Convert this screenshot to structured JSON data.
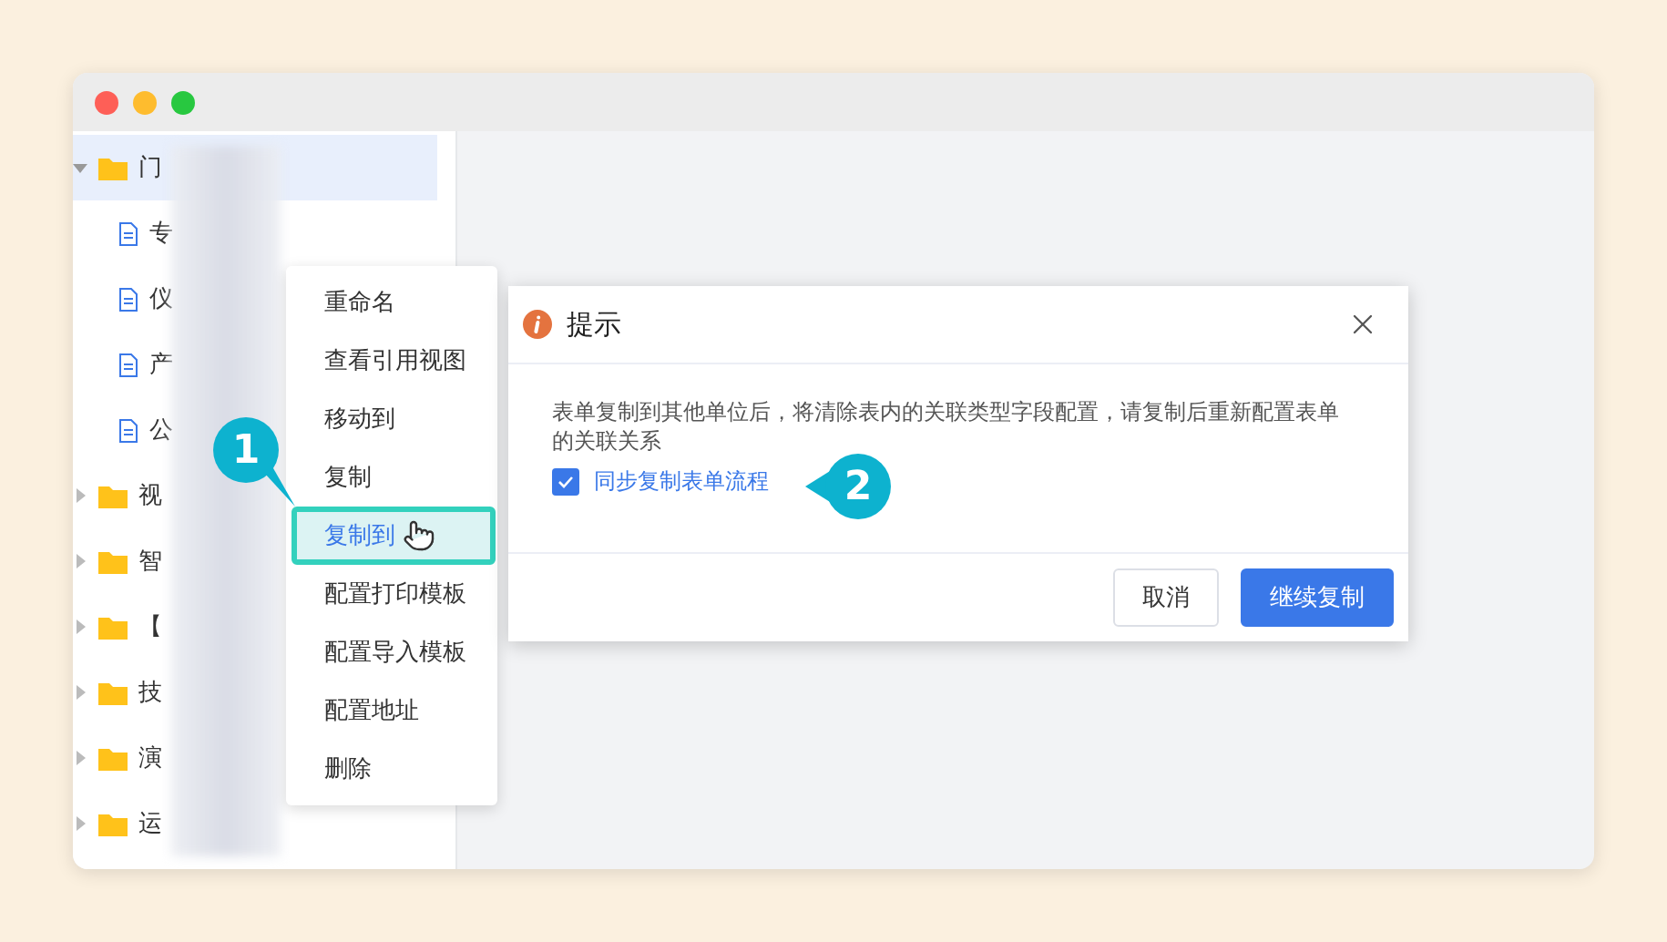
{
  "tree": [
    {
      "kind": "folder",
      "label": "门",
      "expanded": true,
      "selected": true,
      "children": [
        {
          "kind": "file",
          "label": "专",
          "selected": false
        },
        {
          "kind": "file",
          "label": "仪",
          "selected": false
        },
        {
          "kind": "file",
          "label": "产",
          "selected": false
        },
        {
          "kind": "file",
          "label": "公",
          "selected": false
        }
      ]
    },
    {
      "kind": "folder",
      "label": "视",
      "expanded": false,
      "selected": false
    },
    {
      "kind": "folder",
      "label": "智",
      "expanded": false,
      "selected": false
    },
    {
      "kind": "folder",
      "label": "【",
      "expanded": false,
      "selected": false
    },
    {
      "kind": "folder",
      "label": "技",
      "expanded": false,
      "selected": false
    },
    {
      "kind": "folder",
      "label": "演",
      "expanded": false,
      "selected": false
    },
    {
      "kind": "folder",
      "label": "运",
      "expanded": false,
      "selected": false
    }
  ],
  "context_menu": [
    {
      "label": "重命名",
      "selected": false
    },
    {
      "label": "查看引用视图",
      "selected": false
    },
    {
      "label": "移动到",
      "selected": false
    },
    {
      "label": "复制",
      "selected": false
    },
    {
      "label": "复制到",
      "selected": true
    },
    {
      "label": "配置打印模板",
      "selected": false
    },
    {
      "label": "配置导入模板",
      "selected": false
    },
    {
      "label": "配置地址",
      "selected": false
    },
    {
      "label": "删除",
      "selected": false
    }
  ],
  "dialog": {
    "title": "提示",
    "message": "表单复制到其他单位后，将清除表内的关联类型字段配置，请复制后重新配置表单的关联关系",
    "checkbox": {
      "label": "同步复制表单流程",
      "checked": true
    },
    "buttons": [
      {
        "label": "取消",
        "kind": "secondary"
      },
      {
        "label": "继续复制",
        "kind": "primary"
      }
    ]
  },
  "callouts": [
    "1",
    "2"
  ]
}
